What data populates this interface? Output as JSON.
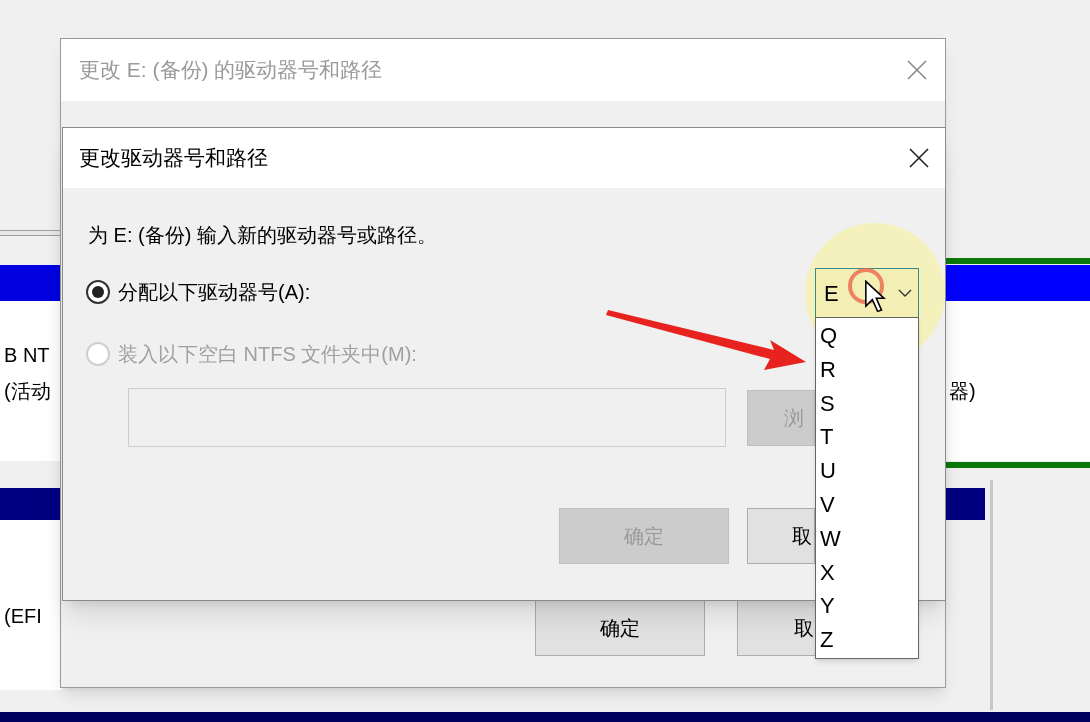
{
  "disk_management": {
    "left_labels": [
      "B NT",
      "(活动"
    ],
    "right_label": "器)",
    "lower_left_label": "(EFI"
  },
  "outer_dialog": {
    "title": "更改 E: (备份) 的驱动器号和路径",
    "buttons": [
      "确定",
      "取"
    ]
  },
  "dialog": {
    "title": "更改驱动器号和路径",
    "prompt": "为 E: (备份) 输入新的驱动器号或路径。",
    "options": [
      {
        "label": "分配以下驱动器号(A):",
        "selected": true,
        "disabled": false
      },
      {
        "label": "装入以下空白 NTFS 文件夹中(M):",
        "selected": false,
        "disabled": true
      }
    ],
    "folder_field": {
      "disabled": true
    },
    "browse_button": {
      "label": "浏",
      "disabled": true
    },
    "buttons": [
      {
        "label": "确定",
        "disabled": true
      },
      {
        "label": "取",
        "disabled": false
      }
    ]
  },
  "drive_letter": {
    "value": "E",
    "expanded": true,
    "options": [
      "Q",
      "R",
      "S",
      "T",
      "U",
      "V",
      "W",
      "X",
      "Y",
      "Z"
    ]
  }
}
